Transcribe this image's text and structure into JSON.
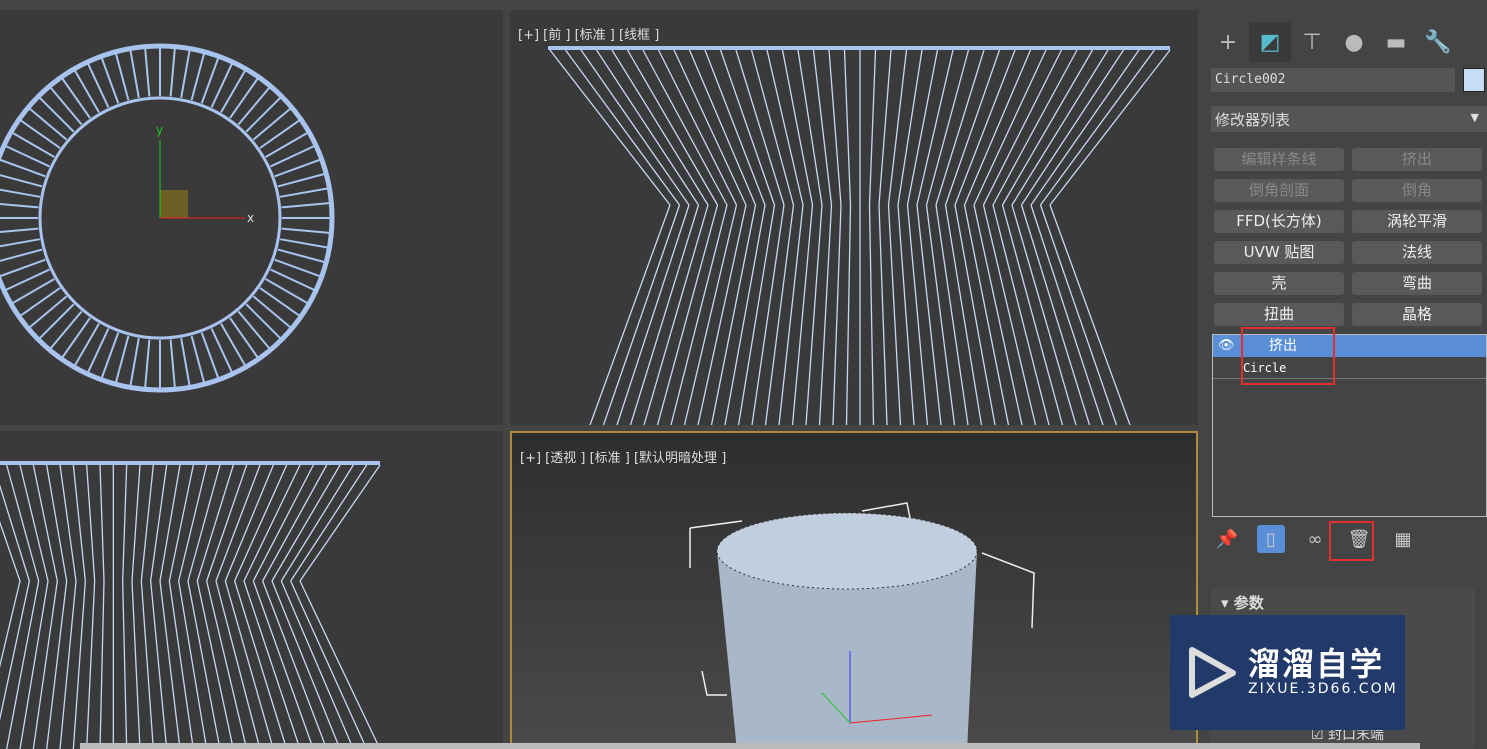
{
  "viewports": {
    "top_left": {
      "label": ""
    },
    "front": {
      "label": "[+] [前 ] [标准 ] [线框 ]"
    },
    "left": {
      "label": ""
    },
    "perspective": {
      "label": "[+] [透视 ] [标准 ] [默认明暗处理 ]"
    }
  },
  "panel": {
    "tabs": [
      {
        "icon": "plus-icon"
      },
      {
        "icon": "modify-icon"
      },
      {
        "icon": "hierarchy-icon"
      },
      {
        "icon": "motion-icon"
      },
      {
        "icon": "display-icon"
      },
      {
        "icon": "utilities-icon"
      }
    ],
    "object_name": "Circle002",
    "object_color": "#c8dcf8",
    "modifier_list": "修改器列表",
    "modifier_buttons": [
      {
        "label": "编辑样条线",
        "enabled": false
      },
      {
        "label": "挤出",
        "enabled": false
      },
      {
        "label": "倒角剖面",
        "enabled": false
      },
      {
        "label": "倒角",
        "enabled": false
      },
      {
        "label": "FFD(长方体)",
        "enabled": true
      },
      {
        "label": "涡轮平滑",
        "enabled": true
      },
      {
        "label": "UVW 贴图",
        "enabled": true
      },
      {
        "label": "法线",
        "enabled": true
      },
      {
        "label": "壳",
        "enabled": true
      },
      {
        "label": "弯曲",
        "enabled": true
      },
      {
        "label": "扭曲",
        "enabled": true
      },
      {
        "label": "晶格",
        "enabled": true
      }
    ],
    "stack": [
      {
        "label": "挤出",
        "selected": true
      },
      {
        "label": "Circle",
        "selected": false
      }
    ],
    "rollout_title": "参数",
    "cap_end": "封口末端"
  },
  "watermark": {
    "text": "溜溜自学",
    "url": "ZIXUE.3D66.COM"
  }
}
